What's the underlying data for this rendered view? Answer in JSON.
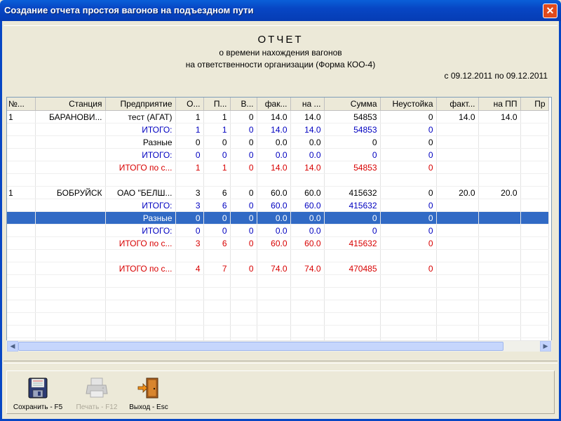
{
  "window": {
    "title": "Создание отчета простоя вагонов на подъездном пути",
    "close": "✕"
  },
  "report": {
    "title": "ОТЧЕТ",
    "line1": "о времени нахождения вагонов",
    "line2": "на ответственности организации (Форма КОО-4)",
    "period": "с 09.12.2011 по 09.12.2011"
  },
  "table": {
    "columns": [
      "№...",
      "Станция",
      "Предприятие",
      "О...",
      "П...",
      "В...",
      "фак...",
      "на ...",
      "Сумма",
      "Неустойка",
      "факт...",
      "на ПП",
      "Пр"
    ],
    "rows": [
      {
        "type": "normal",
        "cells": [
          "1",
          "БАРАНОВИ...",
          "тест (АГАТ)",
          "1",
          "1",
          "0",
          "14.0",
          "14.0",
          "54853",
          "0",
          "14.0",
          "14.0",
          ""
        ]
      },
      {
        "type": "blue",
        "cells": [
          "",
          "",
          "ИТОГО:",
          "1",
          "1",
          "0",
          "14.0",
          "14.0",
          "54853",
          "0",
          "",
          "",
          ""
        ]
      },
      {
        "type": "normal",
        "cells": [
          "",
          "",
          "Разные",
          "0",
          "0",
          "0",
          "0.0",
          "0.0",
          "0",
          "0",
          "",
          "",
          ""
        ]
      },
      {
        "type": "blue",
        "cells": [
          "",
          "",
          "ИТОГО:",
          "0",
          "0",
          "0",
          "0.0",
          "0.0",
          "0",
          "0",
          "",
          "",
          ""
        ]
      },
      {
        "type": "red",
        "cells": [
          "",
          "",
          "ИТОГО по с...",
          "1",
          "1",
          "0",
          "14.0",
          "14.0",
          "54853",
          "0",
          "",
          "",
          ""
        ]
      },
      {
        "type": "empty",
        "cells": [
          "",
          "",
          "",
          "",
          "",
          "",
          "",
          "",
          "",
          "",
          "",
          "",
          ""
        ]
      },
      {
        "type": "normal",
        "cells": [
          "1",
          "БОБРУЙСК",
          "ОАО \"БЕЛШ...",
          "3",
          "6",
          "0",
          "60.0",
          "60.0",
          "415632",
          "0",
          "20.0",
          "20.0",
          ""
        ]
      },
      {
        "type": "blue",
        "cells": [
          "",
          "",
          "ИТОГО:",
          "3",
          "6",
          "0",
          "60.0",
          "60.0",
          "415632",
          "0",
          "",
          "",
          ""
        ]
      },
      {
        "type": "sel",
        "cells": [
          "",
          "",
          "Разные",
          "0",
          "0",
          "0",
          "0.0",
          "0.0",
          "0",
          "0",
          "",
          "",
          ""
        ]
      },
      {
        "type": "blue",
        "cells": [
          "",
          "",
          "ИТОГО:",
          "0",
          "0",
          "0",
          "0.0",
          "0.0",
          "0",
          "0",
          "",
          "",
          ""
        ]
      },
      {
        "type": "red",
        "cells": [
          "",
          "",
          "ИТОГО по с...",
          "3",
          "6",
          "0",
          "60.0",
          "60.0",
          "415632",
          "0",
          "",
          "",
          ""
        ]
      },
      {
        "type": "empty",
        "cells": [
          "",
          "",
          "",
          "",
          "",
          "",
          "",
          "",
          "",
          "",
          "",
          "",
          ""
        ]
      },
      {
        "type": "red",
        "cells": [
          "",
          "",
          "ИТОГО по с...",
          "4",
          "7",
          "0",
          "74.0",
          "74.0",
          "470485",
          "0",
          "",
          "",
          ""
        ]
      },
      {
        "type": "empty",
        "cells": [
          "",
          "",
          "",
          "",
          "",
          "",
          "",
          "",
          "",
          "",
          "",
          "",
          ""
        ]
      },
      {
        "type": "empty",
        "cells": [
          "",
          "",
          "",
          "",
          "",
          "",
          "",
          "",
          "",
          "",
          "",
          "",
          ""
        ]
      },
      {
        "type": "empty",
        "cells": [
          "",
          "",
          "",
          "",
          "",
          "",
          "",
          "",
          "",
          "",
          "",
          "",
          ""
        ]
      },
      {
        "type": "empty",
        "cells": [
          "",
          "",
          "",
          "",
          "",
          "",
          "",
          "",
          "",
          "",
          "",
          "",
          ""
        ]
      },
      {
        "type": "empty",
        "cells": [
          "",
          "",
          "",
          "",
          "",
          "",
          "",
          "",
          "",
          "",
          "",
          "",
          ""
        ]
      },
      {
        "type": "empty",
        "cells": [
          "",
          "",
          "",
          "",
          "",
          "",
          "",
          "",
          "",
          "",
          "",
          "",
          ""
        ]
      }
    ]
  },
  "toolbar": {
    "save_label": "Сохранить - F5",
    "print_label": "Печать - F12",
    "exit_label": "Выход - Esc",
    "save_icon": "floppy-disk-icon",
    "print_icon": "printer-icon",
    "exit_icon": "exit-door-icon"
  },
  "colors": {
    "selection": "#316ac5",
    "subtotal_blue": "#0000c0",
    "total_red": "#d80000",
    "titlebar": "#0746c4"
  }
}
